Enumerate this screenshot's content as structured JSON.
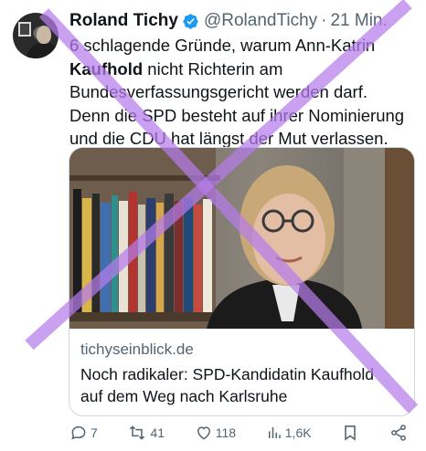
{
  "tweet": {
    "author_name": "Roland Tichy",
    "handle": "@RolandTichy",
    "separator": "·",
    "time": "21 Min.",
    "text_line1": "6 schlagende Gründe, warum Ann-Katrin",
    "text_bold": "Kaufhold",
    "text_line2_rest": " nicht Richterin am",
    "text_line3": "Bundesverfassungsgericht werden darf.",
    "text_line4": "Denn die SPD besteht auf ihrer Nominierung",
    "text_line5": "und die CDU hat längst der Mut verlassen."
  },
  "card": {
    "domain": "tichyseinblick.de",
    "title_line1": "Noch radikaler: SPD-Kandidatin Kaufhold",
    "title_line2": "auf dem Weg nach Karlsruhe"
  },
  "actions": {
    "replies": "7",
    "reposts": "41",
    "likes": "118",
    "views": "1,6K"
  },
  "colors": {
    "verified": "#1d9bf0",
    "muted": "#536471",
    "overlay_cross": "#b57bea"
  }
}
